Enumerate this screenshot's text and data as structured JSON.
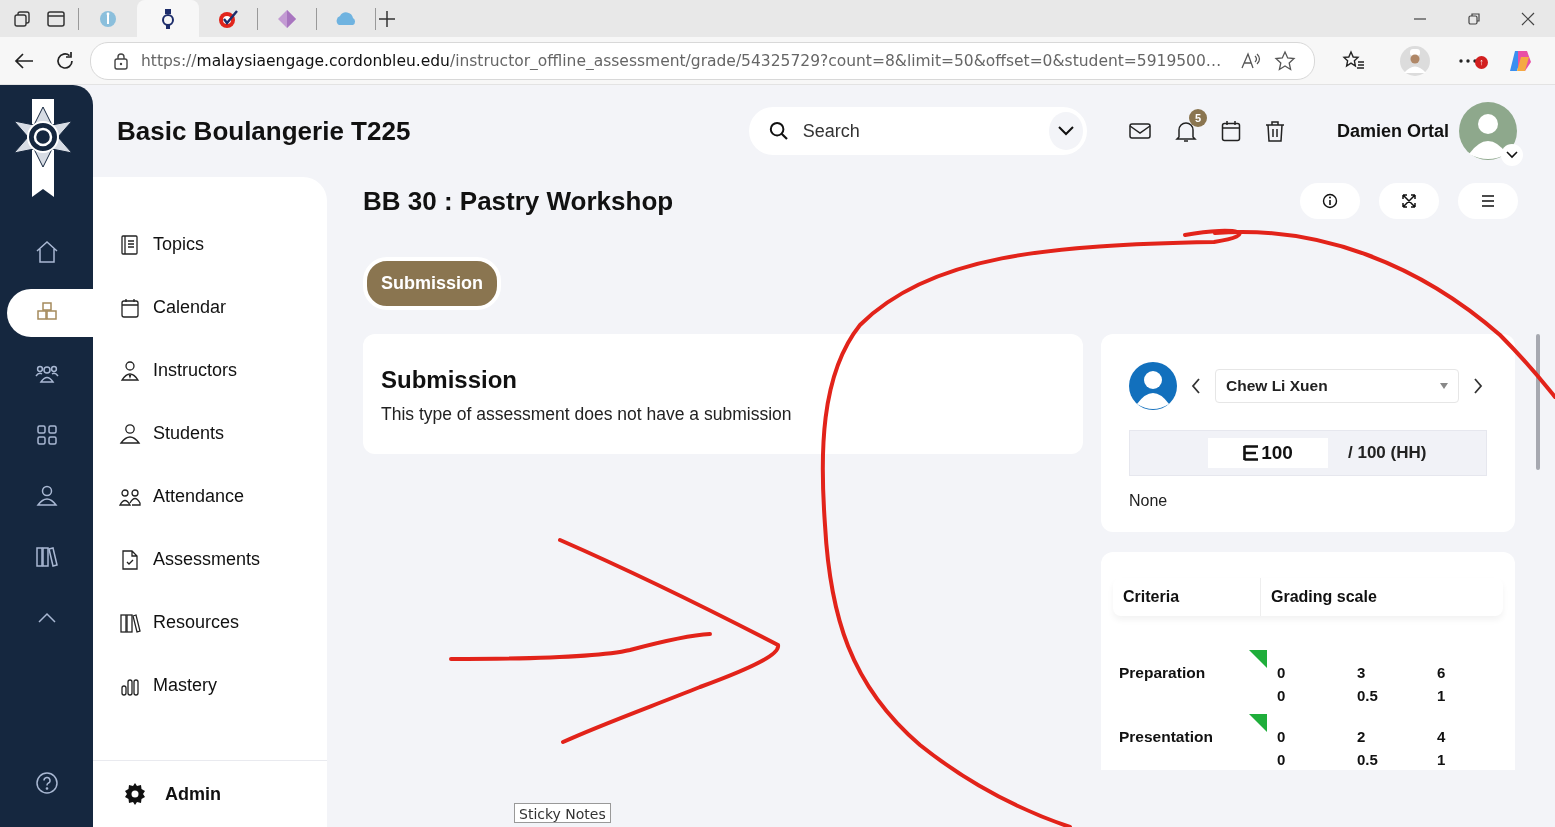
{
  "browser": {
    "tabs": [
      {
        "kind": "info",
        "selected": false
      },
      {
        "kind": "school",
        "selected": true
      },
      {
        "kind": "check",
        "selected": false
      },
      {
        "kind": "diamond",
        "selected": false
      },
      {
        "kind": "cloud",
        "selected": false
      }
    ],
    "url_scheme": "https://",
    "url_host": "malaysiaengage.cordonbleu.edu",
    "url_path": "/instructor_offline_assessment/grade/54325729?count=8&limit=50&offset=0&student=5919500…",
    "update_badge": "↑"
  },
  "rail": [
    {
      "kind": "home",
      "selected": false
    },
    {
      "kind": "cubes",
      "selected": true
    },
    {
      "kind": "people",
      "selected": false
    },
    {
      "kind": "grid",
      "selected": false
    },
    {
      "kind": "person",
      "selected": false
    },
    {
      "kind": "books",
      "selected": false
    },
    {
      "kind": "collapse",
      "selected": false
    }
  ],
  "header": {
    "course_title": "Basic Boulangerie T225",
    "search": {
      "placeholder": "Search"
    },
    "notification_count": "5",
    "user_name": "Damien Ortal"
  },
  "sidebar": {
    "items": [
      {
        "label": "Topics",
        "kind": "book"
      },
      {
        "label": "Calendar",
        "kind": "calendar"
      },
      {
        "label": "Instructors",
        "kind": "instructor"
      },
      {
        "label": "Students",
        "kind": "person"
      },
      {
        "label": "Attendance",
        "kind": "pair"
      },
      {
        "label": "Assessments",
        "kind": "doc"
      },
      {
        "label": "Resources",
        "kind": "books"
      },
      {
        "label": "Mastery",
        "kind": "bars"
      }
    ],
    "admin": "Admin"
  },
  "page": {
    "title": "BB 30 : Pastry Workshop",
    "tabs": [
      {
        "label": "Submission",
        "selected": true
      }
    ]
  },
  "submission": {
    "heading": "Submission",
    "text": "This type of assessment does not have a submission"
  },
  "grader": {
    "student": "Chew Li Xuen",
    "grade": "100",
    "out_of": "/ 100 (HH)",
    "comment": "None"
  },
  "rubric": {
    "columns": [
      "Criteria",
      "Grading scale"
    ],
    "rows": [
      {
        "name": "Preparation",
        "points": [
          "0",
          "3",
          "6"
        ],
        "weights": [
          "0",
          "0.5",
          "1"
        ]
      },
      {
        "name": "Presentation",
        "points": [
          "0",
          "2",
          "4"
        ],
        "weights": [
          "0",
          "0.5",
          "1"
        ]
      }
    ]
  },
  "tooltip": "Sticky Notes"
}
